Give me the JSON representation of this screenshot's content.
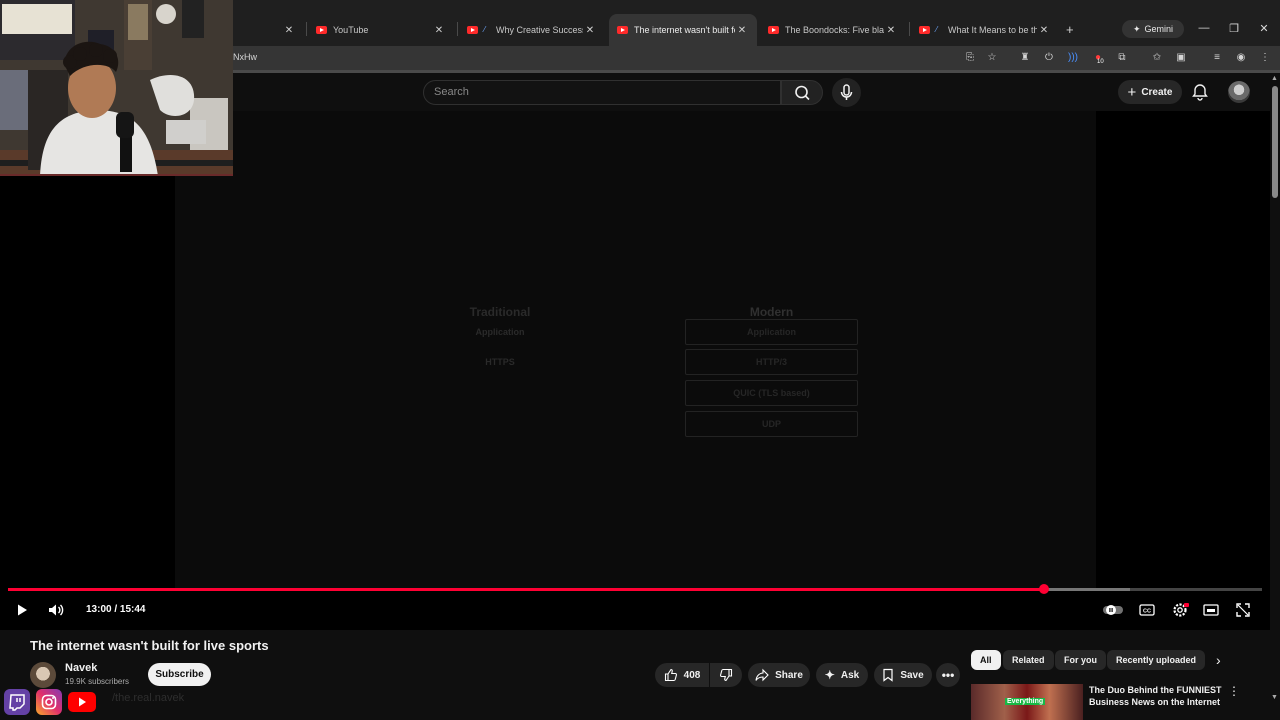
{
  "browser": {
    "tabs": [
      {
        "label": "",
        "favicon": "youtube"
      },
      {
        "label": "YouTube",
        "favicon": "youtube"
      },
      {
        "label": "Why Creative Success De",
        "favicon": "youtube"
      },
      {
        "label": "The internet wasn't built for l",
        "favicon": "youtube",
        "active": true
      },
      {
        "label": "The Boondocks: Five black M",
        "favicon": "youtube"
      },
      {
        "label": "What It Means to be the",
        "favicon": "youtube"
      }
    ],
    "gemini_label": "Gemini",
    "url_fragment": "NxHw",
    "extension_badge": "10"
  },
  "youtube": {
    "search_placeholder": "Search",
    "create_label": "Create"
  },
  "video_content": {
    "left_heading": "Traditional",
    "left_lines": [
      "Application",
      "HTTPS"
    ],
    "right_heading": "Modern",
    "right_boxes": [
      "Application",
      "HTTP/3",
      "QUIC (TLS based)",
      "UDP"
    ]
  },
  "player": {
    "time_display": "13:00 / 15:44",
    "progress_fraction": 0.826,
    "buffer_fraction": 0.895,
    "accent_color": "#ff0033"
  },
  "video_info": {
    "title": "The internet wasn't built for live sports",
    "channel_name": "Navek",
    "subscribers": "19.9K subscribers",
    "subscribe_label": "Subscribe",
    "likes": "408",
    "share_label": "Share",
    "ask_label": "Ask",
    "save_label": "Save"
  },
  "sidebar": {
    "chips": [
      "All",
      "Related",
      "For you",
      "Recently uploaded"
    ],
    "recommendation": {
      "title": "The Duo Behind the FUNNIEST Business News on the Internet",
      "thumb_label": "Everything"
    }
  },
  "overlay": {
    "stream_text": "/the.real.navek"
  }
}
